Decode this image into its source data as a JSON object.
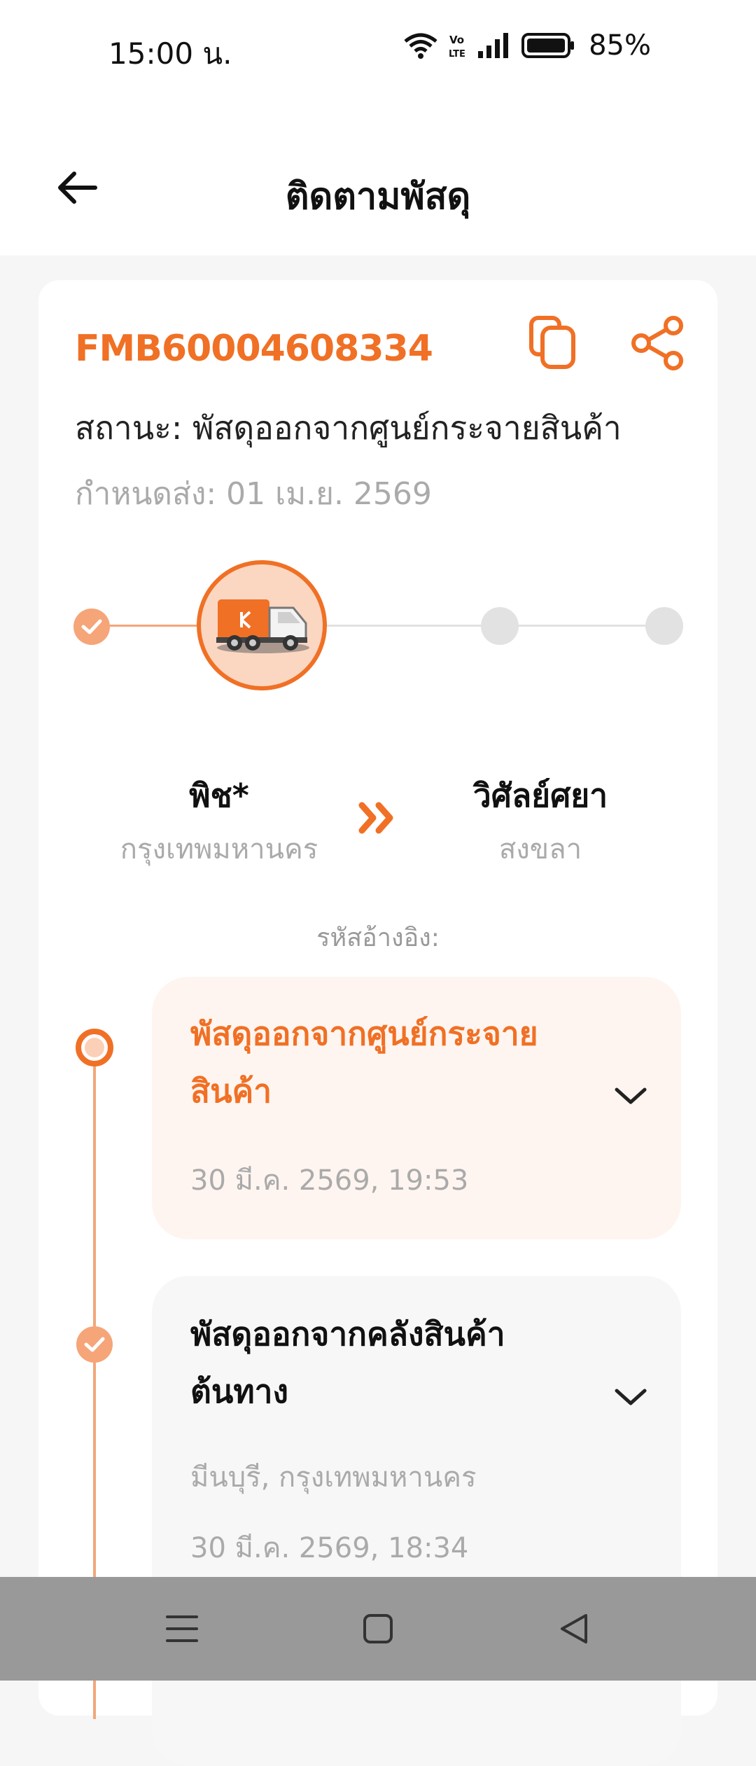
{
  "status_bar": {
    "time": "15:00 น.",
    "battery": "85%",
    "icons": [
      "wifi-icon",
      "volte-icon",
      "signal-icon",
      "battery-icon"
    ]
  },
  "header": {
    "title": "ติดตามพัสดุ",
    "back_icon": "arrow-left-icon"
  },
  "shipment": {
    "tracking_number": "FMB60004608334",
    "status": "สถานะ: พัสดุออกจากศูนย์กระจายสินค้า",
    "due": "กำหนดส่ง: 01 เม.ย. 2569",
    "progress_step": 2,
    "progress_total": 4,
    "sender_name": "พิช*",
    "sender_city": "กรุงเทพมหานคร",
    "receiver_name": "วิศัลย์ศยา",
    "receiver_city": "สงขลา",
    "reference": "รหัสอ้างอิง:"
  },
  "timeline": [
    {
      "title_line1": "พัสดุออกจากศูนย์กระจาย",
      "title_line2": "สินค้า",
      "location": "",
      "datetime": "30 มี.ค. 2569, 19:53",
      "active": true
    },
    {
      "title_line1": "พัสดุออกจากคลังสินค้า",
      "title_line2": "ต้นทาง",
      "location": "มีนบุรี, กรุงเทพมหานคร",
      "datetime": "30 มี.ค. 2569, 18:34",
      "active": false
    }
  ],
  "colors": {
    "accent": "#f07025",
    "accent_light": "#f5a578",
    "active_bg": "#fff5f0",
    "inactive_bg": "#f7f7f7",
    "muted": "#aaaaaa"
  },
  "nav": [
    "menu-icon",
    "home-icon",
    "back-triangle-icon"
  ]
}
